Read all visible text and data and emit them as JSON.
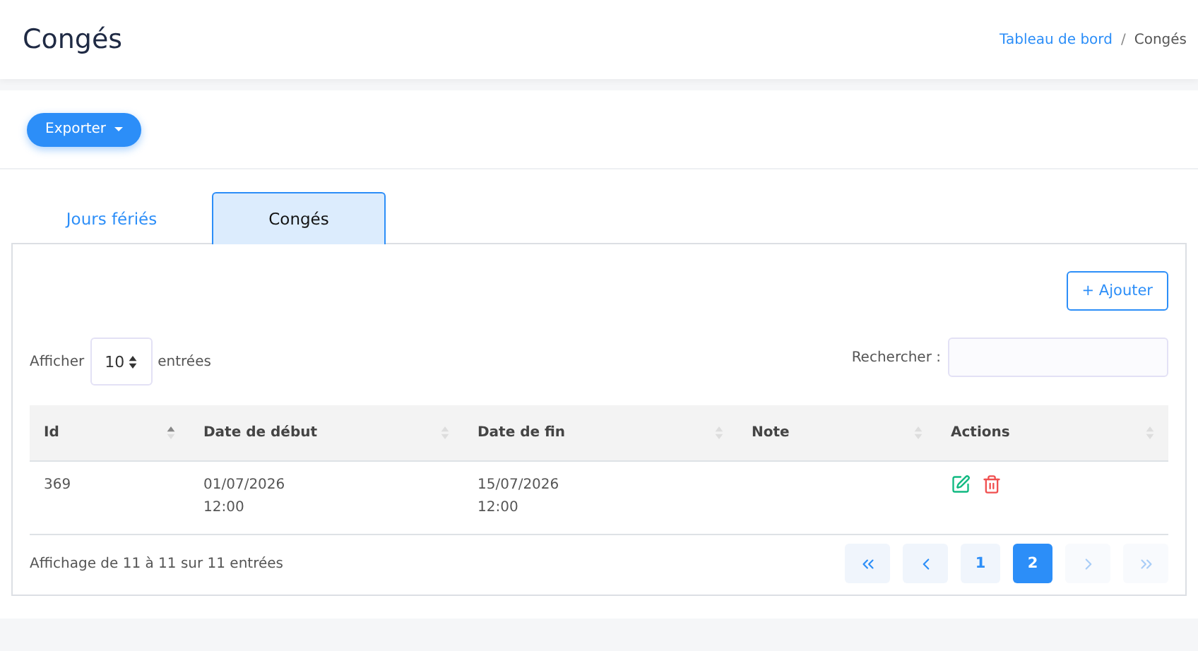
{
  "page_title": "Congés",
  "breadcrumb": [
    {
      "label": "Tableau de bord",
      "kind": "link"
    },
    {
      "label": "Congés",
      "kind": "current"
    }
  ],
  "breadcrumb_separator": "/",
  "export_button": "Exporter",
  "tabs": [
    {
      "label": "Jours fériés",
      "selected": false
    },
    {
      "label": "Congés",
      "selected": true
    }
  ],
  "add_button": "+ Ajouter",
  "length": {
    "before": "Afficher",
    "value": "10",
    "after": "entrées"
  },
  "search": {
    "label": "Rechercher :"
  },
  "table": {
    "columns": [
      {
        "label": "Id",
        "sorted": true
      },
      {
        "label": "Date de début",
        "sorted": false
      },
      {
        "label": "Date de fin",
        "sorted": false
      },
      {
        "label": "Note",
        "sorted": false
      },
      {
        "label": "Actions",
        "sorted": false
      }
    ],
    "rows": [
      {
        "id": "369",
        "start": [
          "01/07/2026",
          "12:00"
        ],
        "end": [
          "15/07/2026",
          "12:00"
        ],
        "note": ""
      }
    ]
  },
  "info": "Affichage de 11 à 11 sur 11 entrées",
  "pagination": [
    {
      "kind": "first",
      "disabled": false
    },
    {
      "kind": "prev",
      "disabled": false
    },
    {
      "kind": "page",
      "label": "1",
      "selected": false
    },
    {
      "kind": "page",
      "label": "2",
      "selected": true
    },
    {
      "kind": "next",
      "disabled": true
    },
    {
      "kind": "last",
      "disabled": true
    }
  ]
}
